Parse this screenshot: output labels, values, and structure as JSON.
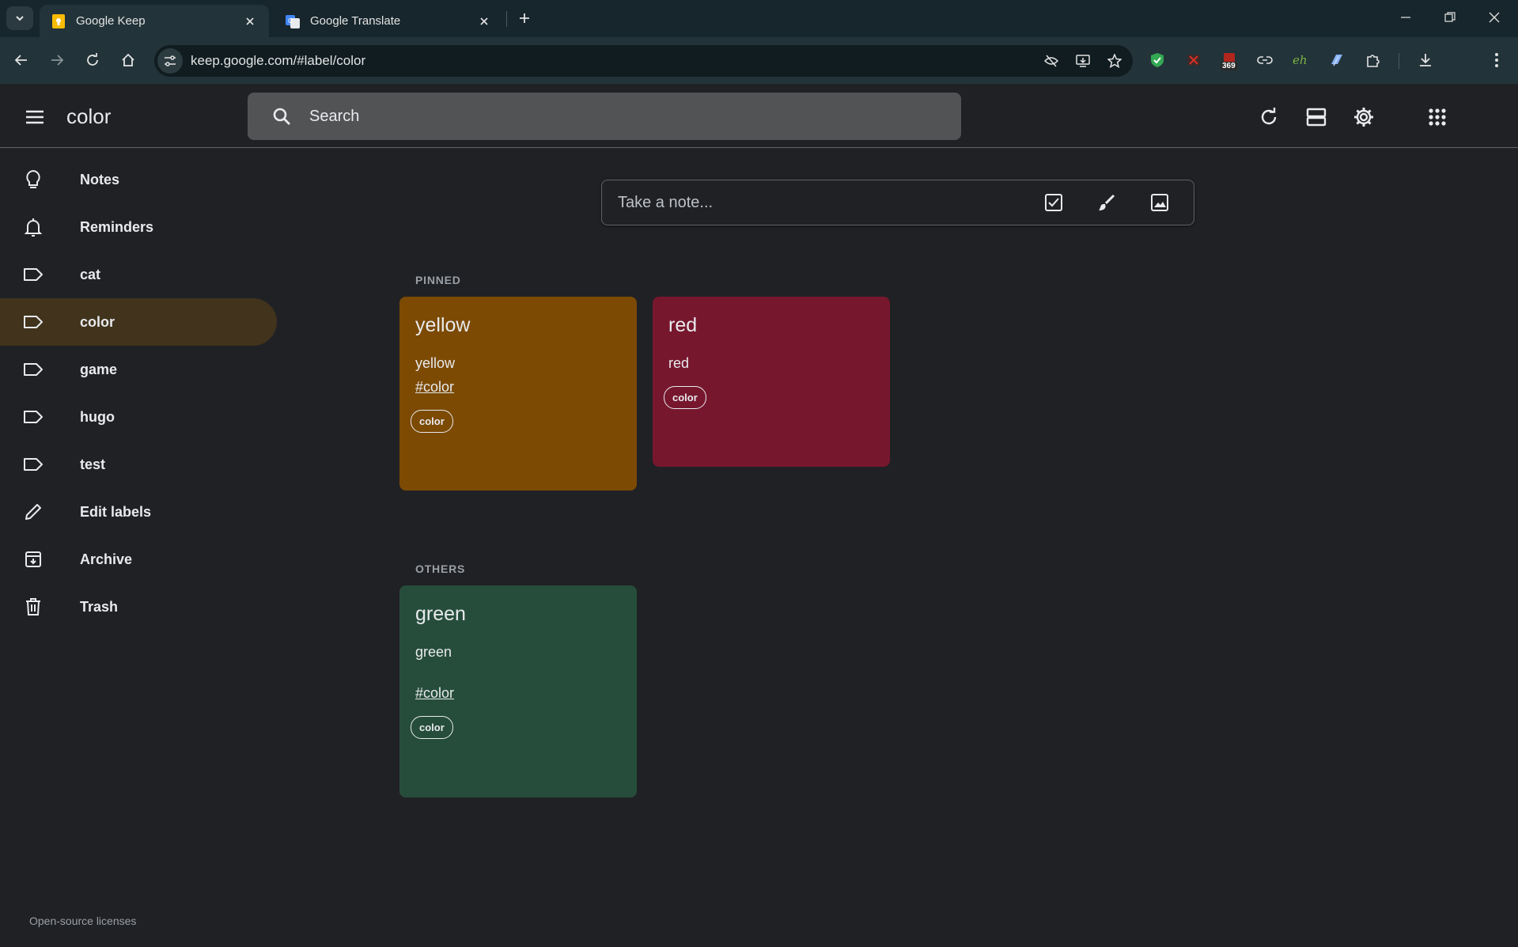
{
  "browser": {
    "tabs": [
      {
        "title": "Google Keep",
        "active": true
      },
      {
        "title": "Google Translate",
        "active": false
      }
    ],
    "url": "keep.google.com/#label/color",
    "extension_badge": "369"
  },
  "header": {
    "title": "color",
    "search_placeholder": "Search"
  },
  "sidebar": {
    "items": [
      {
        "label": "Notes",
        "icon": "lightbulb-icon"
      },
      {
        "label": "Reminders",
        "icon": "bell-icon"
      },
      {
        "label": "cat",
        "icon": "label-icon"
      },
      {
        "label": "color",
        "icon": "label-icon",
        "active": true
      },
      {
        "label": "game",
        "icon": "label-icon"
      },
      {
        "label": "hugo",
        "icon": "label-icon"
      },
      {
        "label": "test",
        "icon": "label-icon"
      },
      {
        "label": "Edit labels",
        "icon": "pencil-icon"
      },
      {
        "label": "Archive",
        "icon": "archive-icon"
      },
      {
        "label": "Trash",
        "icon": "trash-icon"
      }
    ],
    "footer": "Open-source licenses"
  },
  "take_note": {
    "placeholder": "Take a note..."
  },
  "sections": {
    "pinned": "PINNED",
    "others": "OTHERS"
  },
  "notes": {
    "yellow": {
      "title": "yellow",
      "body": "yellow",
      "hashtag": "#color",
      "label": "color",
      "color": "#7c4a03"
    },
    "red": {
      "title": "red",
      "body": "red",
      "label": "color",
      "color": "#77172e"
    },
    "green": {
      "title": "green",
      "body": "green",
      "hashtag": "#color",
      "label": "color",
      "color": "#264d3b"
    }
  },
  "colors": {
    "background": "#202124",
    "active_label": "#41331c",
    "chrome_tabstrip": "#17262c",
    "chrome_toolbar": "#223339"
  }
}
